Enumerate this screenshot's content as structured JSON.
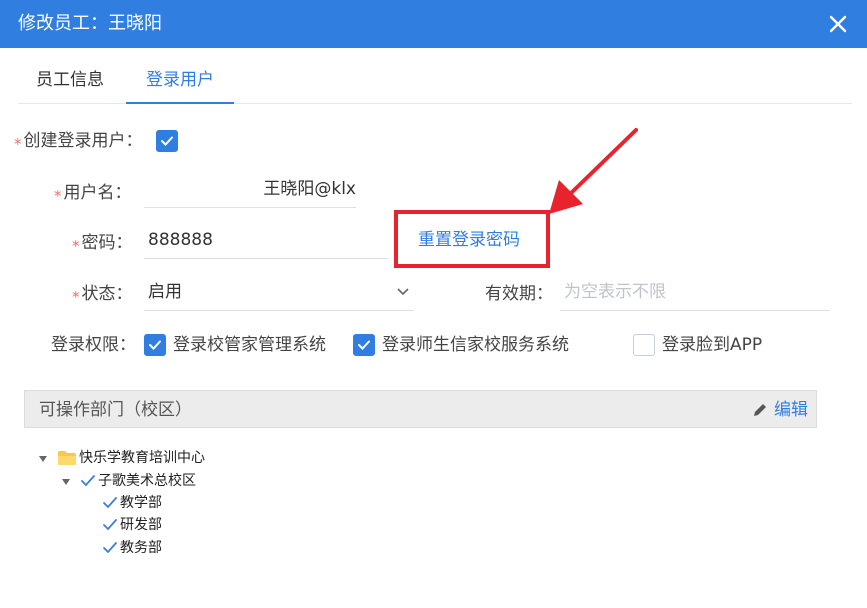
{
  "dialog": {
    "title": "修改员工：王晓阳"
  },
  "tabs": [
    {
      "label": "员工信息",
      "active": false
    },
    {
      "label": "登录用户",
      "active": true
    }
  ],
  "form": {
    "create_login": {
      "label": "创建登录用户：",
      "checked": true
    },
    "username": {
      "label": "用户名：",
      "value": "王晓阳@klx"
    },
    "password": {
      "label": "密码：",
      "value": "888888"
    },
    "reset_password": "重置登录密码",
    "status": {
      "label": "状态：",
      "value": "启用"
    },
    "validity": {
      "label": "有效期：",
      "placeholder": "为空表示不限"
    },
    "permissions": {
      "label": "登录权限：",
      "items": [
        {
          "label": "登录校管家管理系统",
          "checked": true
        },
        {
          "label": "登录师生信家校服务系统",
          "checked": true
        },
        {
          "label": "登录脸到APP",
          "checked": false
        }
      ]
    }
  },
  "departments": {
    "title": "可操作部门（校区）",
    "edit_label": "编辑",
    "tree": {
      "root": "快乐学教育培训中心",
      "campus": "子歌美术总校区",
      "children": [
        "教学部",
        "研发部",
        "教务部"
      ]
    }
  },
  "colors": {
    "primary": "#2f7ee0",
    "required": "#f56c6c",
    "annotation": "#e8232d"
  }
}
